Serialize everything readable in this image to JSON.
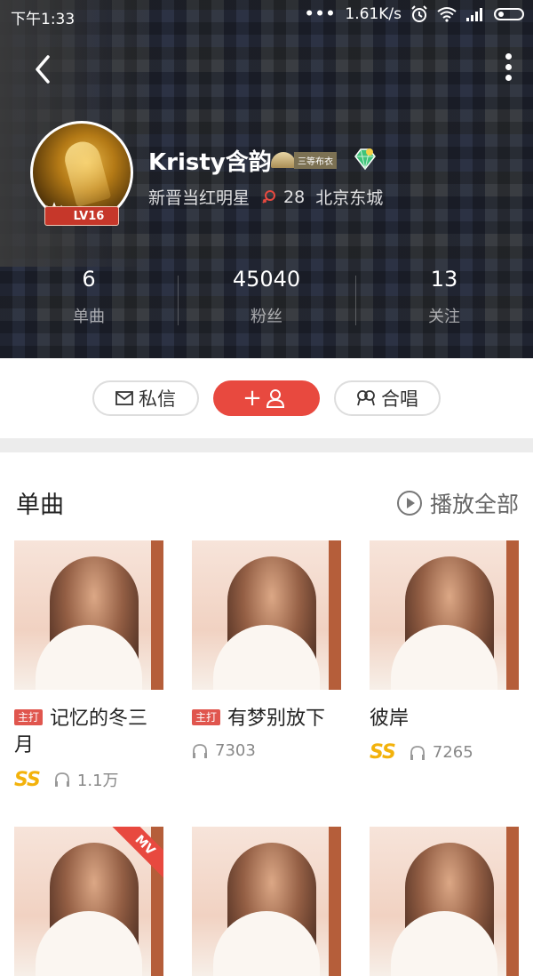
{
  "status": {
    "time": "下午1:33",
    "dots": "•••",
    "speed": "1.61K/s"
  },
  "profile": {
    "name": "Kristy含韵",
    "rank_label": "三等布衣",
    "title": "新晋当红明星",
    "age": "28",
    "location": "北京东城",
    "level": "LV16"
  },
  "stats": [
    {
      "num": "6",
      "label": "单曲"
    },
    {
      "num": "45040",
      "label": "粉丝"
    },
    {
      "num": "13",
      "label": "关注"
    }
  ],
  "actions": {
    "message": "私信",
    "follow": "+",
    "duet": "合唱"
  },
  "songs_section": {
    "title": "单曲",
    "play_all": "播放全部"
  },
  "songs": [
    {
      "tag": "主打",
      "title": "记忆的冬三月",
      "grade": "SS",
      "plays": "1.1万"
    },
    {
      "tag": "主打",
      "title": "有梦别放下",
      "grade": "",
      "plays": "7303"
    },
    {
      "tag": "",
      "title": "彼岸",
      "grade": "SS",
      "plays": "7265"
    }
  ],
  "second_row": {
    "mv_tag": "MV"
  },
  "colors": {
    "accent": "#e8493f",
    "grade": "#f3b20b"
  }
}
